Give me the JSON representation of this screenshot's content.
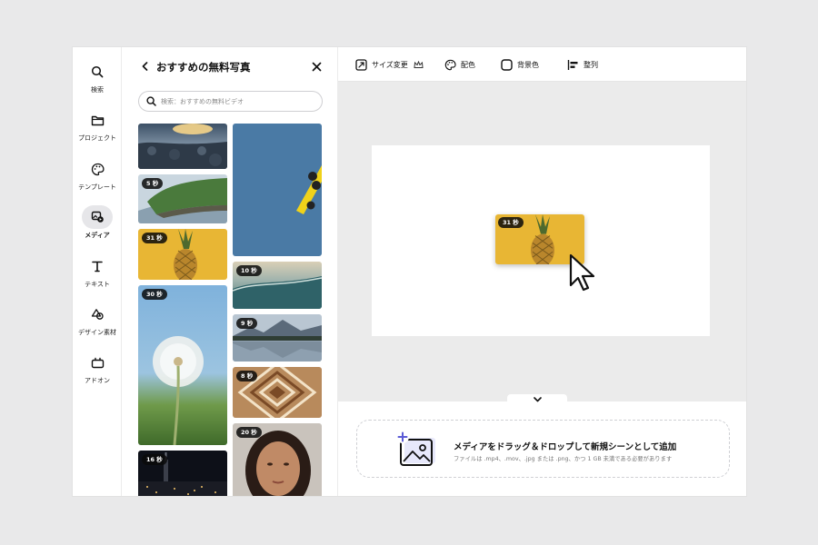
{
  "sidebar": {
    "items": [
      {
        "label": "検索",
        "icon": "search-icon"
      },
      {
        "label": "プロジェクト",
        "icon": "folder-icon"
      },
      {
        "label": "テンプレート",
        "icon": "palette-icon"
      },
      {
        "label": "メディア",
        "icon": "media-icon",
        "active": true
      },
      {
        "label": "テキスト",
        "icon": "text-icon"
      },
      {
        "label": "デザイン素材",
        "icon": "shapes-icon"
      },
      {
        "label": "アドオン",
        "icon": "addon-icon"
      }
    ]
  },
  "panel": {
    "title": "おすすめの無料写真",
    "search_placeholder": "検索：おすすめの無料ビデオ",
    "thumbnails": [
      {
        "scene": "sunset-shore"
      },
      {
        "scene": "cliff-coast",
        "duration": "5 秒"
      },
      {
        "scene": "pineapple",
        "duration": "31 秒"
      },
      {
        "scene": "dandelion",
        "duration": "30 秒"
      },
      {
        "scene": "city-night",
        "duration": "16 秒"
      },
      {
        "scene": "skateboard-sky"
      },
      {
        "scene": "ocean-wave",
        "duration": "10 秒"
      },
      {
        "scene": "mountain-lake",
        "duration": "9 秒"
      },
      {
        "scene": "geometric-pattern",
        "duration": "8 秒"
      },
      {
        "scene": "portrait-woman",
        "duration": "20 秒"
      }
    ]
  },
  "toolbar": {
    "resize_label": "サイズ変更",
    "color_label": "配色",
    "background_label": "背景色",
    "align_label": "整列"
  },
  "canvas": {
    "dragged_clip_duration": "31 秒"
  },
  "dropzone": {
    "title": "メディアをドラッグ＆ドロップして新規シーンとして追加",
    "subtitle": "ファイルは .mp4、.mov、.jpg または .png、かつ 1 GB 未満である必要があります"
  },
  "colors": {
    "accent": "#5b5bd6",
    "rail_active": "#e6e6e9",
    "canvas_bg": "#ebebeb"
  }
}
